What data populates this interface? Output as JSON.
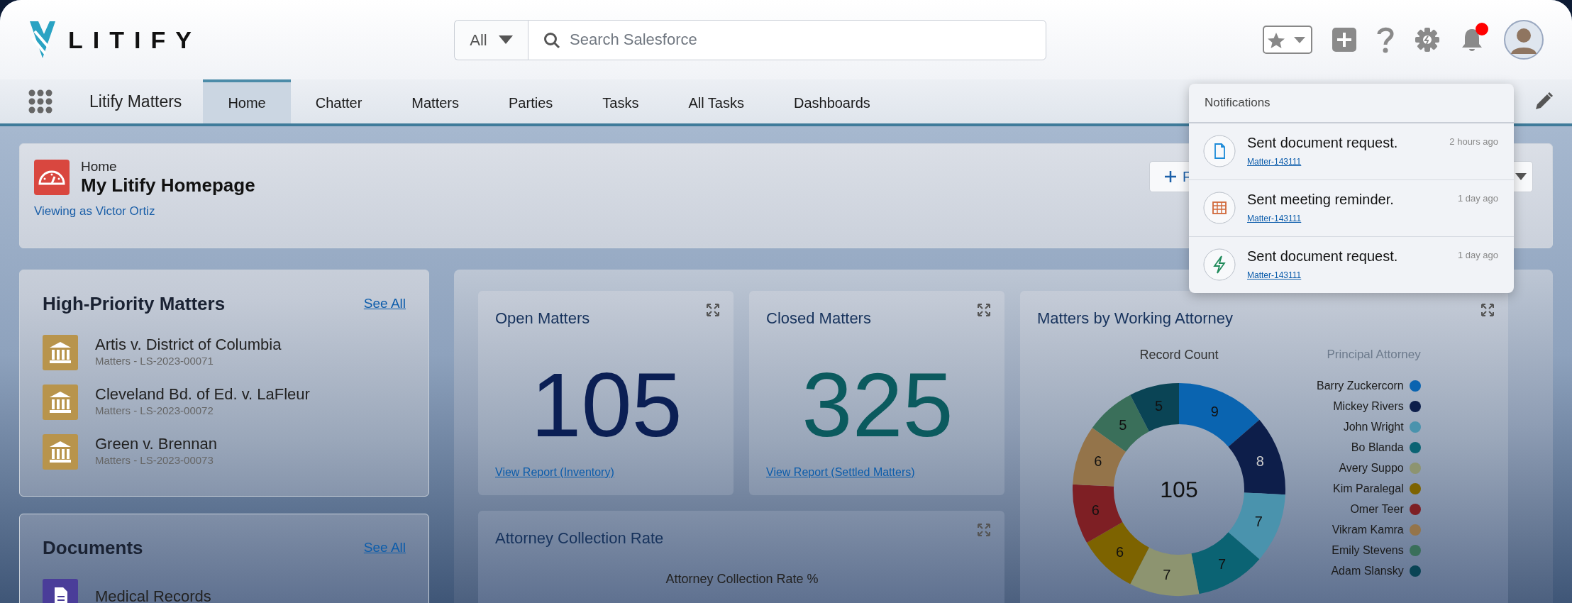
{
  "header": {
    "logo_text": "LITIFY",
    "search": {
      "scope": "All",
      "placeholder": "Search Salesforce"
    },
    "notification_unread": true
  },
  "nav": {
    "app_name": "Litify Matters",
    "tabs": [
      {
        "label": "Home",
        "selected": true
      },
      {
        "label": "Chatter",
        "selected": false
      },
      {
        "label": "Matters",
        "selected": false
      },
      {
        "label": "Parties",
        "selected": false
      },
      {
        "label": "Tasks",
        "selected": false
      },
      {
        "label": "All Tasks",
        "selected": false
      },
      {
        "label": "Dashboards",
        "selected": false
      }
    ]
  },
  "page_header": {
    "object": "Home",
    "title": "My Litify Homepage",
    "viewing_as": "Viewing as Victor Ortiz",
    "button_label": "F"
  },
  "high_priority": {
    "title": "High-Priority Matters",
    "see_all": "See All",
    "items": [
      {
        "name": "Artis v. District of Columbia",
        "subtitle": "Matters - LS-2023-00071"
      },
      {
        "name": "Cleveland Bd. of Ed. v. LaFleur",
        "subtitle": "Matters - LS-2023-00072"
      },
      {
        "name": "Green v. Brennan",
        "subtitle": "Matters - LS-2023-00073"
      }
    ]
  },
  "documents": {
    "title": "Documents",
    "see_all": "See All",
    "items": [
      {
        "name": "Medical Records"
      }
    ]
  },
  "dashboard": {
    "metrics": [
      {
        "title": "Open Matters",
        "value": "105",
        "link": "View Report (Inventory)",
        "color": "#0b1f54"
      },
      {
        "title": "Closed Matters",
        "value": "325",
        "link": "View Report (Settled Matters)",
        "color": "#0b5a5e"
      }
    ],
    "attorney_chart": {
      "title": "Matters by Working Attorney",
      "total": "105",
      "legend_title": "Principal Attorney",
      "legend": [
        {
          "color": "#0a64b0"
        },
        {
          "color": "#0d1e4a"
        },
        {
          "color": "#4a93ad"
        },
        {
          "color": "#0b6373"
        },
        {
          "color": "#8d9470"
        },
        {
          "color": "#7d6300"
        },
        {
          "color": "#7e1f24"
        },
        {
          "color": "#94744a"
        },
        {
          "color": "#3a6f5a"
        },
        {
          "color": "#0a4455"
        }
      ],
      "chart_data": {
        "type": "donut",
        "title": "Record Count",
        "categories": [
          "Barry Zuckercorn",
          "Mickey Rivers",
          "John Wright",
          "Bo Blanda",
          "Avery Suppo",
          "Kim Paralegal",
          "Omer Teer",
          "Vikram Kamra",
          "Emily Stevens",
          "Adam Slansky"
        ],
        "values": [
          9,
          8,
          7,
          7,
          7,
          6,
          6,
          6,
          5,
          5
        ],
        "data_labels": true
      }
    },
    "collection_rate": {
      "title": "Attorney Collection Rate",
      "chart_title": "Attorney Collection Rate %"
    }
  },
  "notifications": {
    "title": "Notifications",
    "items": [
      {
        "kind": "document",
        "text": "Sent document request.",
        "link": "Matter-143111",
        "time": "2 hours ago"
      },
      {
        "kind": "event",
        "text": "Sent meeting reminder.",
        "link": "Matter-143111",
        "time": "1 day ago"
      },
      {
        "kind": "action",
        "text": "Sent document request.",
        "link": "Matter-143111",
        "time": "1 day ago"
      }
    ]
  }
}
